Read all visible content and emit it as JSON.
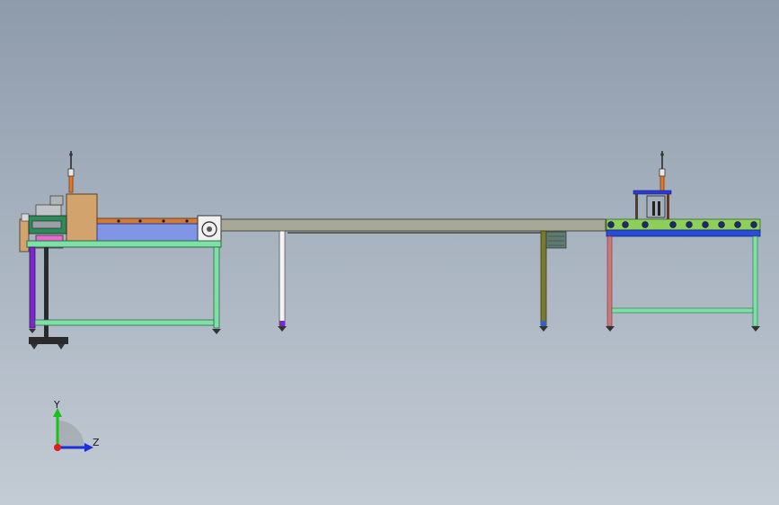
{
  "viewport": {
    "background_top": "#8e9bab",
    "background_bottom": "#c3cbd4"
  },
  "triad": {
    "y_label": "Y",
    "z_label": "Z",
    "y_color": "#19c219",
    "z_color": "#1a2fd6",
    "origin_color": "#e01e1e"
  },
  "machine": {
    "frame_green": "#7fe0a6",
    "frame_purple": "#7a28c8",
    "conveyor_blue": "#8095e6",
    "box_tan": "#d2a36c",
    "long_table_top": "#a8a896",
    "right_table_blue": "#2a4bd6",
    "right_leg_red": "#c77a7a",
    "right_leg_green": "#7fe0a6",
    "roller_green": "#8ccf5a"
  }
}
